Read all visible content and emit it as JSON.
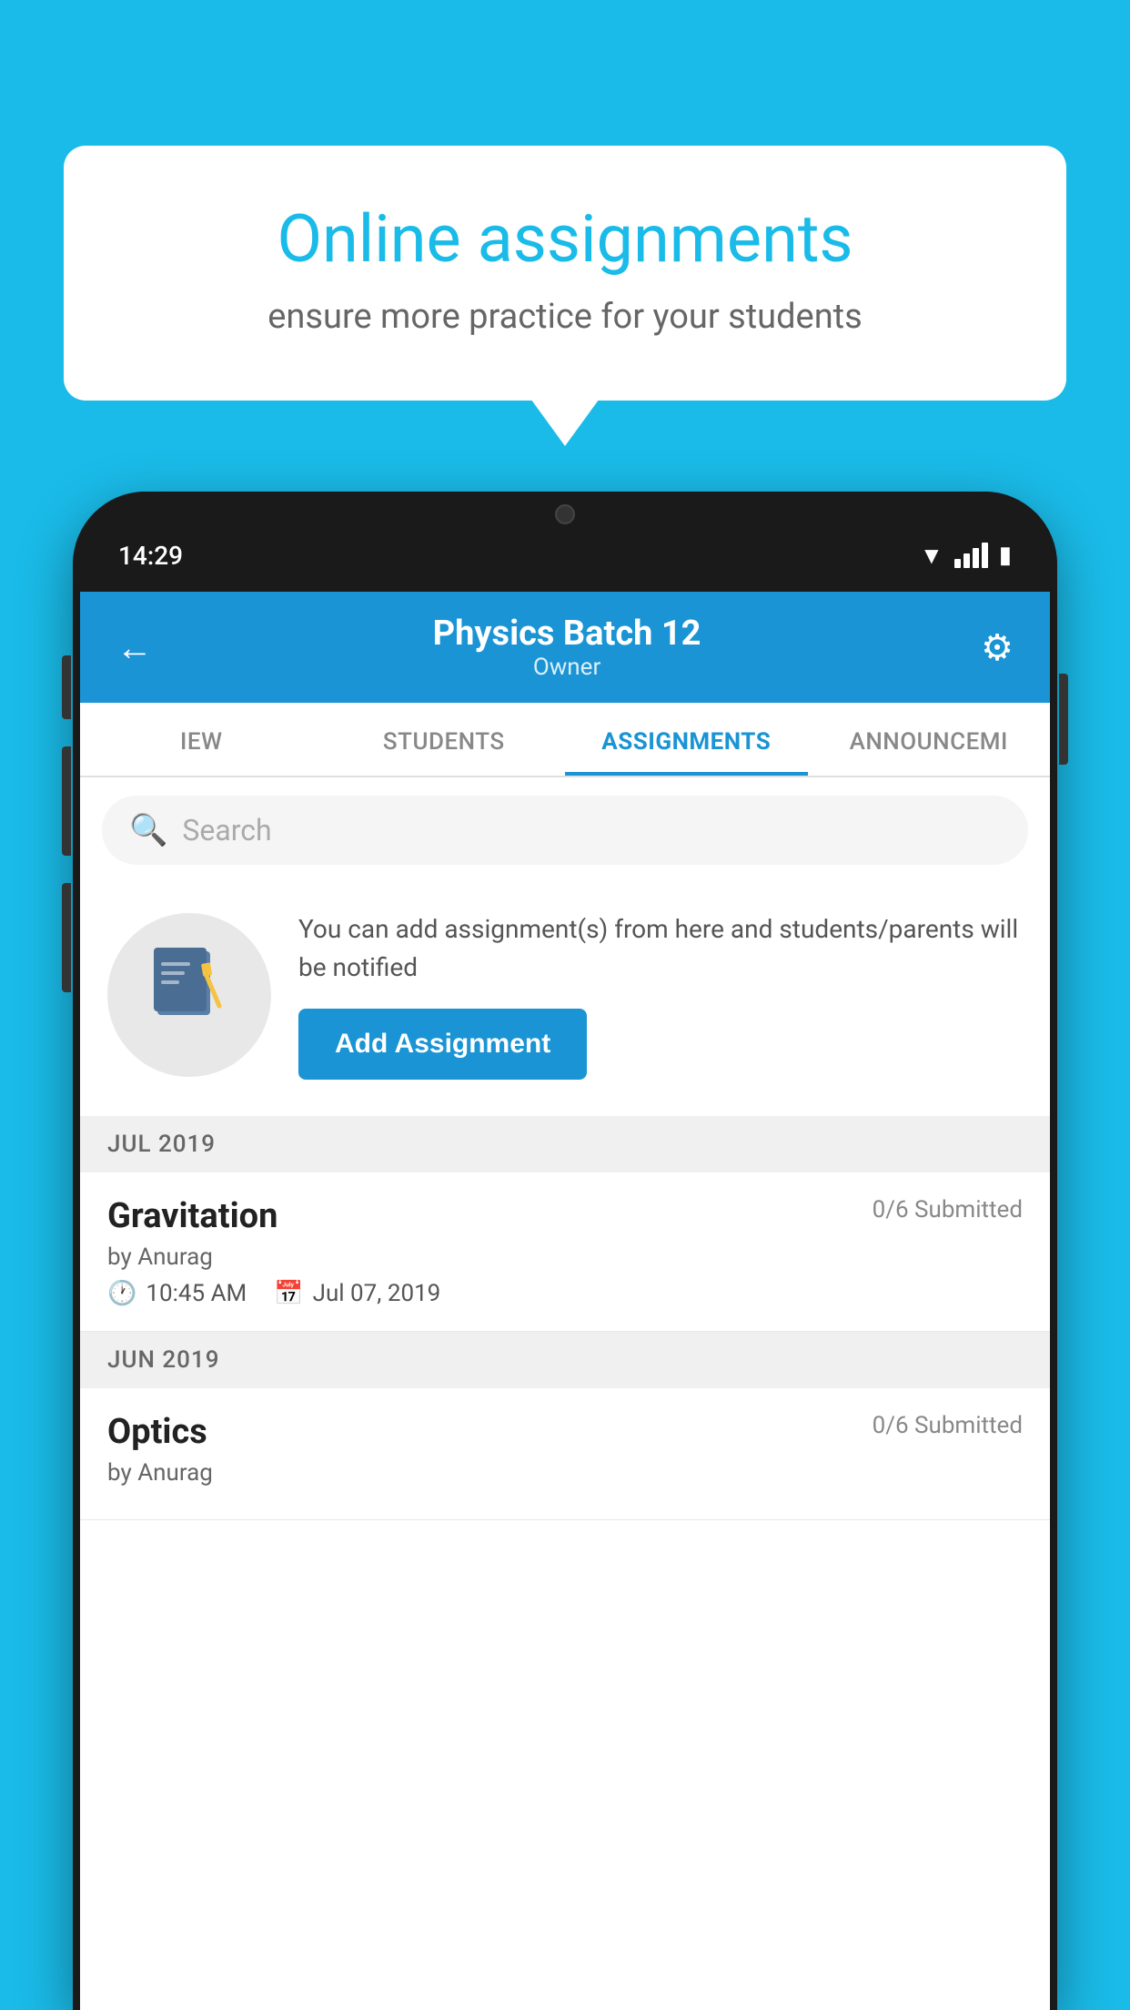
{
  "background_color": "#1ABBE8",
  "speech_bubble": {
    "title": "Online assignments",
    "subtitle": "ensure more practice for your students"
  },
  "phone": {
    "status_bar": {
      "time": "14:29",
      "wifi": true,
      "signal": true,
      "battery": true
    },
    "header": {
      "title": "Physics Batch 12",
      "subtitle": "Owner",
      "back_label": "←",
      "settings_label": "⚙"
    },
    "tabs": [
      {
        "label": "IEW",
        "active": false
      },
      {
        "label": "STUDENTS",
        "active": false
      },
      {
        "label": "ASSIGNMENTS",
        "active": true
      },
      {
        "label": "ANNOUNCEMI",
        "active": false
      }
    ],
    "search": {
      "placeholder": "Search"
    },
    "empty_state": {
      "description": "You can add assignment(s) from here and students/parents will be notified",
      "button_label": "Add Assignment"
    },
    "sections": [
      {
        "label": "JUL 2019",
        "assignments": [
          {
            "title": "Gravitation",
            "submitted": "0/6 Submitted",
            "by": "by Anurag",
            "time": "10:45 AM",
            "date": "Jul 07, 2019"
          }
        ]
      },
      {
        "label": "JUN 2019",
        "assignments": [
          {
            "title": "Optics",
            "submitted": "0/6 Submitted",
            "by": "by Anurag",
            "time": "",
            "date": ""
          }
        ]
      }
    ]
  }
}
